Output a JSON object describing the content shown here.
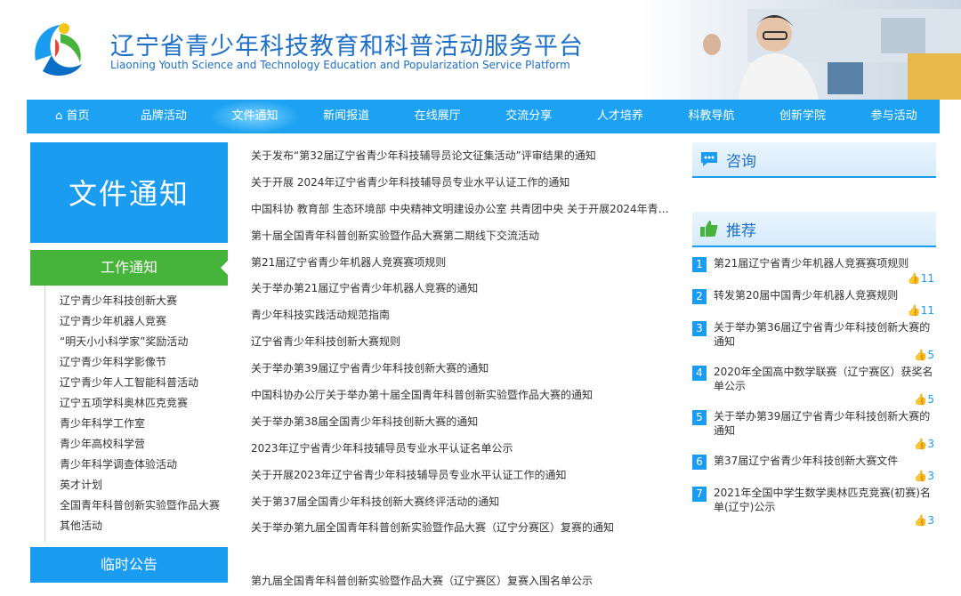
{
  "site": {
    "title": "辽宁省青少年科技教育和科普活动服务平台",
    "subtitle": "Liaoning Youth Science and Technology Education and Popularization Service Platform"
  },
  "nav": [
    {
      "label": "首页"
    },
    {
      "label": "品牌活动"
    },
    {
      "label": "文件通知"
    },
    {
      "label": "新闻报道"
    },
    {
      "label": "在线展厅"
    },
    {
      "label": "交流分享"
    },
    {
      "label": "人才培养"
    },
    {
      "label": "科教导航"
    },
    {
      "label": "创新学院"
    },
    {
      "label": "参与活动"
    }
  ],
  "left": {
    "banner": "文件通知",
    "section_title": "工作通知",
    "items": [
      "辽宁青少年科技创新大赛",
      "辽宁青少年机器人竞赛",
      "“明天小小科学家”奖励活动",
      "辽宁青少年科学影像节",
      "辽宁青少年人工智能科普活动",
      "辽宁五项学科奥林匹克竞赛",
      "青少年科学工作室",
      "青少年高校科学营",
      "青少年科学调查体验活动",
      "英才计划",
      "全国青年科普创新实验暨作品大赛",
      "其他活动"
    ],
    "section2_title": "临时公告"
  },
  "notices": [
    "关于发布“第32届辽宁省青少年科技辅导员论文征集活动”评审结果的通知",
    "关于开展 2024年辽宁省青少年科技辅导员专业水平认证工作的通知",
    "中国科协 教育部 生态环境部 中央精神文明建设办公室 共青团中央 关于开展2024年青少…",
    "第十届全国青年科普创新实验暨作品大赛第二期线下交流活动",
    "第21届辽宁省青少年机器人竞赛赛项规则",
    "关于举办第21届辽宁省青少年机器人竞赛的通知",
    "青少年科技实践活动规范指南",
    "辽宁省青少年科技创新大赛规则",
    "关于举办第39届辽宁省青少年科技创新大赛的通知",
    "中国科协办公厅关于举办第十届全国青年科普创新实验暨作品大赛的通知",
    "关于举办第38届全国青少年科技创新大赛的通知",
    "2023年辽宁省青少年科技辅导员专业水平认证名单公示",
    "关于开展2023年辽宁省青少年科技辅导员专业水平认证工作的通知",
    "关于第37届全国青少年科技创新大赛终评活动的通知",
    "关于举办第九届全国青年科普创新实验暨作品大赛（辽宁分赛区）复赛的通知",
    "",
    "第九届全国青年科普创新实验暨作品大赛（辽宁赛区）复赛入围名单公示"
  ],
  "right": {
    "consult_title": "咨询",
    "recommend_title": "推荐",
    "items": [
      {
        "num": "1",
        "text": "第21届辽宁省青少年机器人竞赛赛项规则",
        "likes": "11"
      },
      {
        "num": "2",
        "text": "转发第20届中国青少年机器人竞赛规则",
        "likes": "11"
      },
      {
        "num": "3",
        "text": "关于举办第36届辽宁省青少年科技创新大赛的通知",
        "likes": "5"
      },
      {
        "num": "4",
        "text": "2020年全国高中数学联赛（辽宁赛区）获奖名单公示",
        "likes": "5"
      },
      {
        "num": "5",
        "text": "关于举办第39届辽宁省青少年科技创新大赛的通知",
        "likes": "3"
      },
      {
        "num": "6",
        "text": "第37届辽宁省青少年科技创新大赛文件",
        "likes": "3"
      },
      {
        "num": "7",
        "text": "2021年全国中学生数学奥林匹克竞赛(初赛)名单(辽宁)公示",
        "likes": "3"
      }
    ]
  },
  "colors": {
    "brand_blue": "#1da1f2",
    "green": "#46b33a",
    "title_blue": "#1d6fc7"
  }
}
